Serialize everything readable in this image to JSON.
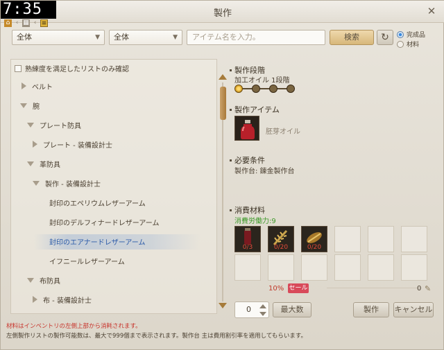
{
  "window": {
    "title": "製作",
    "close_glyph": "✕"
  },
  "clock": "7:35",
  "filters": {
    "category1": "全体",
    "category2": "全体",
    "search_placeholder": "アイテム名を入力。",
    "search_button": "検索",
    "refresh_glyph": "↻",
    "radio_options": [
      "完成品",
      "材料"
    ],
    "radio_selected": "完成品"
  },
  "left": {
    "checkbox_label": "熟練度を満足したリストのみ確認",
    "tree": [
      {
        "label": "ベルト",
        "state": "collapsed",
        "level": 0
      },
      {
        "label": "腕",
        "state": "expanded",
        "level": 0
      },
      {
        "label": "プレート防具",
        "state": "expanded",
        "level": 1
      },
      {
        "label": "プレート - 装備設計士",
        "state": "collapsed",
        "level": 2
      },
      {
        "label": "革防具",
        "state": "expanded",
        "level": 1
      },
      {
        "label": "製作 - 装備設計士",
        "state": "expanded",
        "level": 2
      },
      {
        "label": "封印のエペリウムレザーアーム",
        "state": "leaf",
        "level": 3
      },
      {
        "label": "封印のデルフィナードレザーアーム",
        "state": "leaf",
        "level": 3
      },
      {
        "label": "封印のエアナードレザーアーム",
        "state": "leaf-selected",
        "level": 3
      },
      {
        "label": "イフニールレザーアーム",
        "state": "leaf",
        "level": 3
      },
      {
        "label": "布防具",
        "state": "expanded",
        "level": 1
      },
      {
        "label": "布 - 装備設計士",
        "state": "collapsed",
        "level": 2
      }
    ]
  },
  "right": {
    "craft_stage_title": "製作段階",
    "craft_stage_value": "加工オイル 1段階",
    "stages_active": 1,
    "stages_total": 4,
    "craft_item_title": "製作アイテム",
    "craft_item_name": "胚芽オイル",
    "requirement_title": "必要条件",
    "requirement_value": "製作台: 錬金製作台",
    "materials_title": "消費材料",
    "labor_cost": "消費労働力:9",
    "materials": [
      {
        "icon": "red-potion-icon",
        "count": "0/3"
      },
      {
        "icon": "wheat-icon",
        "count": "0/20"
      },
      {
        "icon": "grain-bundle-icon",
        "count": "0/20"
      }
    ],
    "discount_pct": "10%",
    "sale_label": "セール",
    "cost_value": "0",
    "quantity": "0",
    "max_button": "最大数",
    "craft_button": "製作",
    "cancel_button": "キャンセル"
  },
  "notes": {
    "line1": "材料はインベントリの左側上部から消耗されます。",
    "line2": "左側製作リストの製作可能数は、最大で999個まで表示されます。製作台 主は費用割引率を適用してもらいます。"
  },
  "colors": {
    "accent": "#c58a2a",
    "selected_text": "#2a5aa8",
    "alert": "#c8322a",
    "labor_green": "#3e9a2a",
    "sale_bg": "#d84a5a"
  }
}
